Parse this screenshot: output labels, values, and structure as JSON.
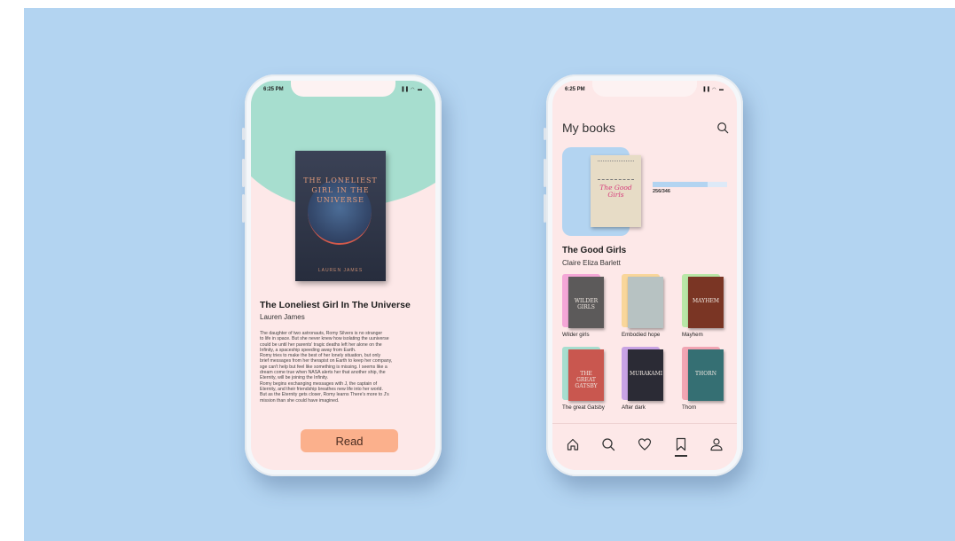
{
  "status_bar": {
    "time": "6:25 PM",
    "icons": "▐▐ ◠ ▬"
  },
  "detail": {
    "cover_title": "THE LONELIEST GIRL IN THE UNIVERSE",
    "cover_author": "LAUREN JAMES",
    "title": "The Loneliest Girl In The Universe",
    "author": "Lauren James",
    "description": "The daughter of two astronauts, Romy Silvers is no stranger\nto life in space. But she never  knew how isolating the uuniverse\ncould be until her parents' tragic deaths left her alone on the\nInfinity, a spaceship speeding away from Earth.\nRomy tries to make the best of her lonely situation, but only\nbrief messages from her therapist on Earth to keep her company,\nsge can't help but feel like something is missing. I seems like a\ndream come true when NASA alerts her that another ship, the\nEternity, will be joining the Infinity.\nRomy begins exchanging messages with J, the captain of\nEternity, and their friendship breathes new life into her world.\nBut as the Eternity gets closer, Romy learns There's more to J's\nmission than she could have imagined.",
    "read_label": "Read"
  },
  "library": {
    "title": "My books",
    "current": {
      "cover_text": "The Good Girls",
      "title": "The Good Girls",
      "author": "Claire Eliza Barlett",
      "progress_label": "256/346",
      "progress_fraction": 0.74
    },
    "books": [
      {
        "label": "Wilder girls",
        "bg": "#f4a6d7",
        "cover": "#5c5a5a",
        "cover_text": "WILDER GIRLS"
      },
      {
        "label": "Embodied hope",
        "bg": "#f9d69a",
        "cover": "#b7c2c2",
        "cover_text": ""
      },
      {
        "label": "Mayhem",
        "bg": "#b9e7a7",
        "cover": "#7a3524",
        "cover_text": "MAYHEM"
      },
      {
        "label": "The great Gatsby",
        "bg": "#a7decf",
        "cover": "#c9574f",
        "cover_text": "THE GREAT GATSBY"
      },
      {
        "label": "After dark",
        "bg": "#c8a3e4",
        "cover": "#2b2b35",
        "cover_text": "MURAKAMI"
      },
      {
        "label": "Thorn",
        "bg": "#f2a5b3",
        "cover": "#356f73",
        "cover_text": "THORN"
      }
    ]
  },
  "nav": {
    "items": [
      "home-icon",
      "search-icon",
      "heart-icon",
      "bookmark-icon",
      "user-icon"
    ],
    "active": "bookmark-icon"
  },
  "colors": {
    "background": "#b3d4f1",
    "screen": "#fde8e8",
    "accent_green": "#a7decf",
    "read_button": "#fbb08c"
  }
}
